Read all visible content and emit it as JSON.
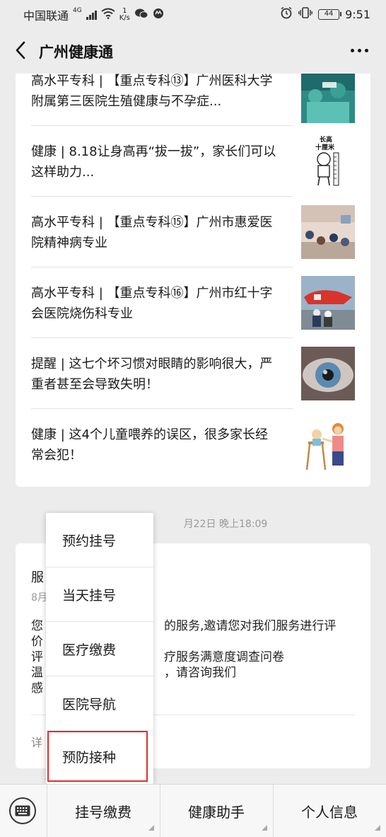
{
  "status_bar": {
    "carrier": "中国联通",
    "network": "4G",
    "speed_value": "1",
    "speed_unit": "K/s",
    "battery": "44",
    "time": "9:51"
  },
  "header": {
    "title": "广州健康通"
  },
  "articles": [
    {
      "text": "高水平专科 | 【重点专科⑬】广州医科大学附属第三医院生殖健康与不孕症..."
    },
    {
      "text": "健康 | 8.18让身高再“拔一拔”，家长们可以这样助力...",
      "thumb_text_1": "长高",
      "thumb_text_2": "十厘米"
    },
    {
      "text": "高水平专科 | 【重点专科⑮】广州市惠爱医院精神病专业"
    },
    {
      "text": "高水平专科 | 【重点专科⑯】广州市红十字会医院烧伤科专业"
    },
    {
      "text": "提醒 | 这七个坏习惯对眼睛的影响很大，严重者甚至会导致失明！"
    },
    {
      "text": "健康 | 这4个儿童喂养的误区，很多家长经常会犯！"
    }
  ],
  "timestamp": "月22日 晚上18:09",
  "service_card": {
    "title_fragment": "服",
    "date_fragment": "8月",
    "lines": [
      {
        "left": "您",
        "right": "的服务,邀请您对我们服务进行评"
      },
      {
        "left": "价",
        "right": ""
      },
      {
        "left": "评",
        "right": "疗服务满意度调查问卷"
      },
      {
        "left": "温",
        "right": "，请咨询我们"
      },
      {
        "left": "感",
        "right": ""
      }
    ],
    "detail_fragment": "详"
  },
  "popup_menu": {
    "items": [
      {
        "label": "预约挂号"
      },
      {
        "label": "当天挂号"
      },
      {
        "label": "医疗缴费"
      },
      {
        "label": "医院导航"
      },
      {
        "label": "预防接种"
      }
    ]
  },
  "bottom_menu": {
    "tabs": [
      {
        "label": "挂号缴费"
      },
      {
        "label": "健康助手"
      },
      {
        "label": "个人信息"
      }
    ]
  },
  "colors": {
    "highlight_border": "#e02d2d",
    "background": "#ececec"
  }
}
